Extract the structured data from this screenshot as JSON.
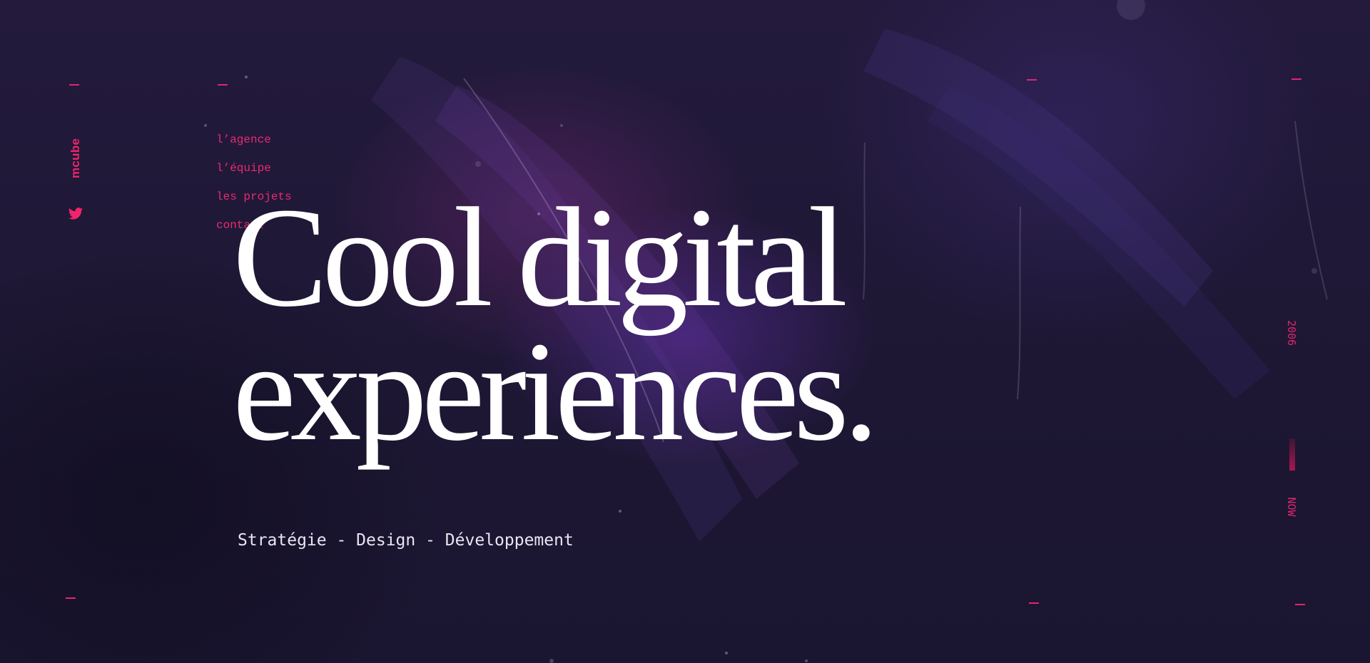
{
  "brand": {
    "logo_text": "mcube"
  },
  "social": {
    "twitter_icon": "twitter-icon"
  },
  "nav": {
    "items": [
      {
        "label": "l’agence"
      },
      {
        "label": "l’équipe"
      },
      {
        "label": "les projets"
      },
      {
        "label": "contact"
      }
    ]
  },
  "hero": {
    "headline_line1": "Cool digital",
    "headline_line2": "experiences.",
    "subtitle": "Stratégie - Design - Développement"
  },
  "timeline": {
    "start": "2006",
    "end": "NOW"
  },
  "colors": {
    "accent": "#e92a72",
    "background": "#1f1833",
    "headline": "#ffffff"
  }
}
